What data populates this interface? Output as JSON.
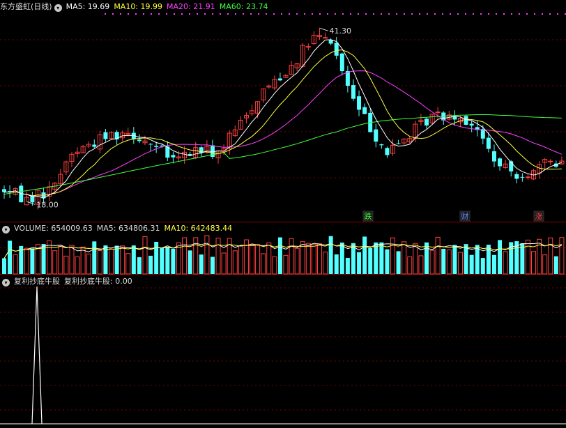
{
  "legend_main": {
    "name": "东方盛虹(日线)",
    "ma5": "MA5: 19.69",
    "ma10": "MA10: 19.99",
    "ma20": "MA20: 21.91",
    "ma60": "MA60: 23.74"
  },
  "legend_volume": {
    "name": "VOLUME: 654009.63",
    "ma5": "MA5: 634806.31",
    "ma10": "MA10: 642483.44"
  },
  "legend_indicator": {
    "name": "复利抄底牛股",
    "value_label": "复利抄底牛股: 0.00"
  },
  "icons": {
    "toggle": "chevron-down-icon"
  },
  "colors": {
    "up": "#ff4040",
    "down": "#54ffff",
    "ma5": "#ffffff",
    "ma10": "#ffff40",
    "ma20": "#ff40ff",
    "ma60": "#40ff40",
    "grid": "#800000",
    "indicator_line": "#ffffff"
  },
  "chart_data": [
    {
      "type": "candlestick",
      "title": "东方盛虹(日线)",
      "annotations": [
        {
          "text": "41.30",
          "kind": "period-high"
        },
        {
          "text": "18.00",
          "kind": "period-low"
        }
      ],
      "event_markers": [
        {
          "text": "跌",
          "color": "#40ff40"
        },
        {
          "text": "财",
          "color": "#5a8cff"
        },
        {
          "text": "涨",
          "color": "#ff4040"
        }
      ],
      "series": [
        {
          "name": "MA5",
          "last": 19.69
        },
        {
          "name": "MA10",
          "last": 19.99
        },
        {
          "name": "MA20",
          "last": 21.91
        },
        {
          "name": "MA60",
          "last": 23.74
        }
      ],
      "ylim": [
        17,
        43
      ],
      "grid": true
    },
    {
      "type": "bar",
      "title": "VOLUME",
      "series": [
        {
          "name": "VOLUME",
          "last": 654009.63
        },
        {
          "name": "MA5",
          "last": 634806.31
        },
        {
          "name": "MA10",
          "last": 642483.44
        }
      ]
    },
    {
      "type": "line",
      "title": "复利抄底牛股",
      "series": [
        {
          "name": "复利抄底牛股",
          "last": 0.0,
          "spike_count": 1
        }
      ]
    }
  ]
}
